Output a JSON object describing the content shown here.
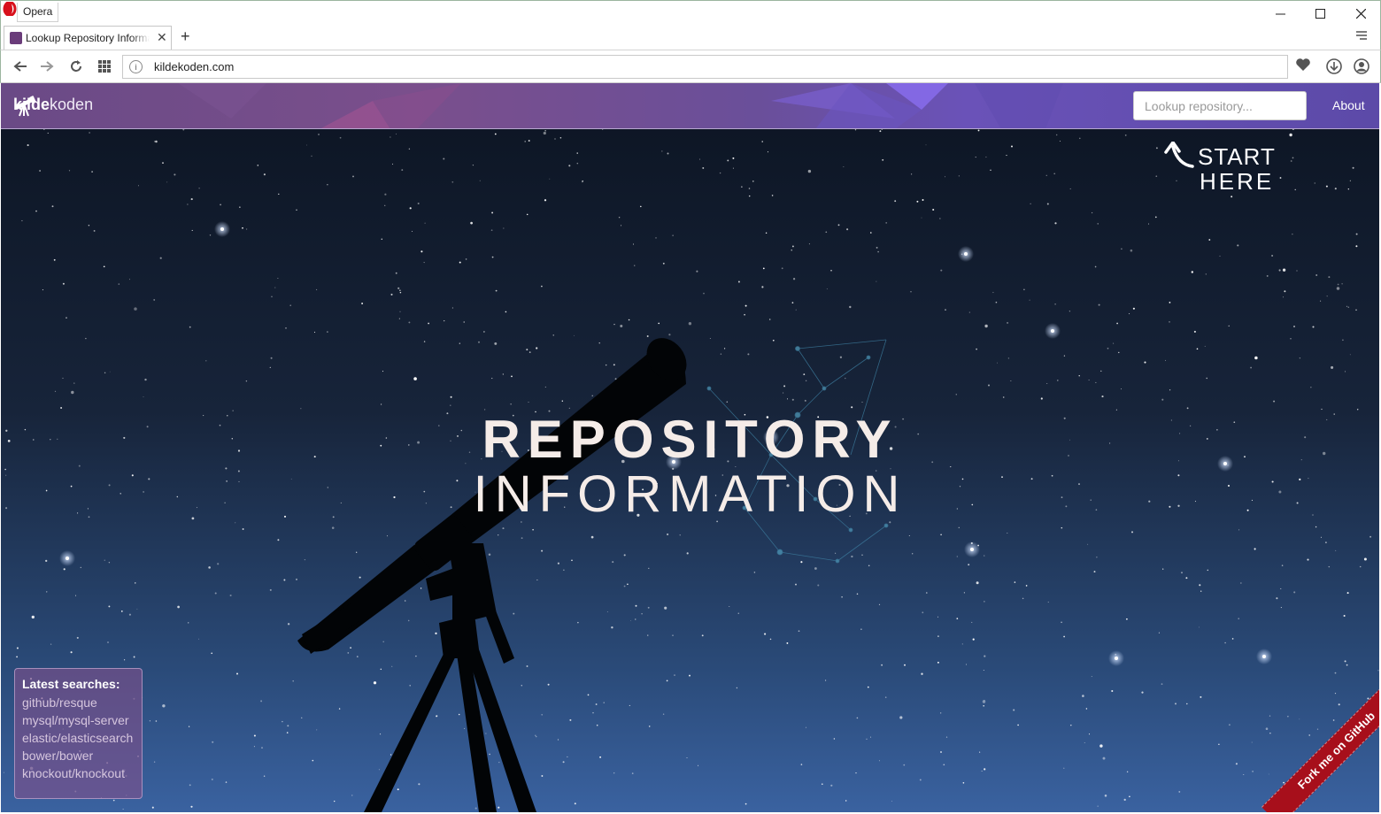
{
  "window": {
    "app_name": "Opera"
  },
  "tab": {
    "title": "Lookup Repository Information"
  },
  "address_bar": {
    "url": "kildekoden.com"
  },
  "site": {
    "brand_bold": "kilde",
    "brand_light": "koden",
    "search_placeholder": "Lookup repository...",
    "about_label": "About",
    "start_here_line1": "START",
    "start_here_line2": "HERE",
    "hero_line1": "REPOSITORY",
    "hero_line2": "INFORMATION",
    "latest_title": "Latest searches:",
    "latest_searches": [
      "github/resque",
      "mysql/mysql-server",
      "elastic/elasticsearch",
      "bower/bower",
      "knockout/knockout"
    ],
    "fork_ribbon": "Fork me on GitHub"
  },
  "colors": {
    "navbar": "#6a4f9a",
    "ribbon": "#a70f1b",
    "hero_text": "#f5ece8"
  }
}
